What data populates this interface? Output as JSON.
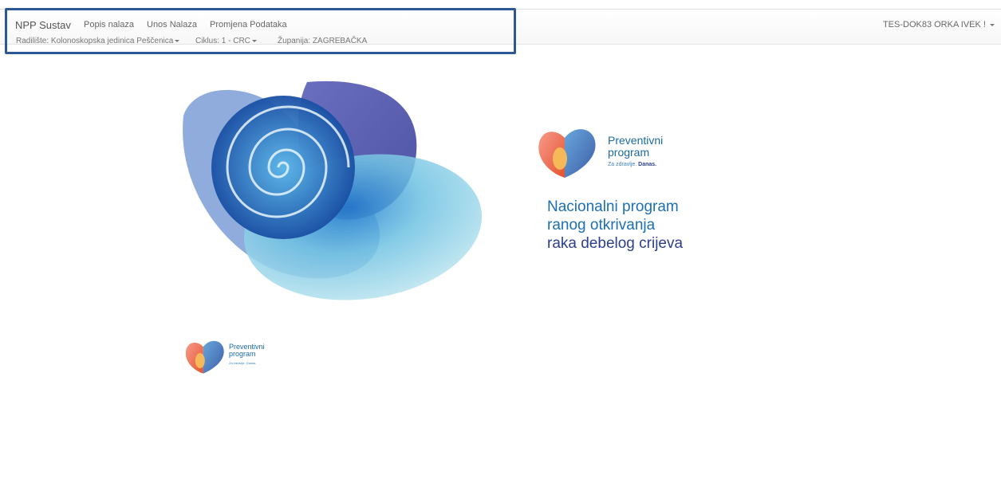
{
  "navbar": {
    "brand": "NPP Sustav",
    "links": [
      "Popis nalaza",
      "Unos Nalaza",
      "Promjena Podataka"
    ],
    "radiliste": "Radilište: Kolonoskopska jedinica Peščenica",
    "ciklus": "Ciklus: 1 - CRC",
    "zupanija": "Županija: ZAGREBAČKA",
    "user": "TES-DOK83 ORKA IVEK !",
    "highlight_color": "#2e5795"
  },
  "branding": {
    "program_line1": "Preventivni",
    "program_line2": "program",
    "tagline_prefix": "Za zdravlje.",
    "tagline_emphasis": "Danas.",
    "headline": [
      "Nacionalni program",
      "ranog otkrivanja",
      "raka debelog crijeva"
    ]
  },
  "colors": {
    "primary_blue": "#1d6fb3",
    "dark_blue": "#2c3e8f",
    "light_cyan": "#b8e2ec"
  }
}
